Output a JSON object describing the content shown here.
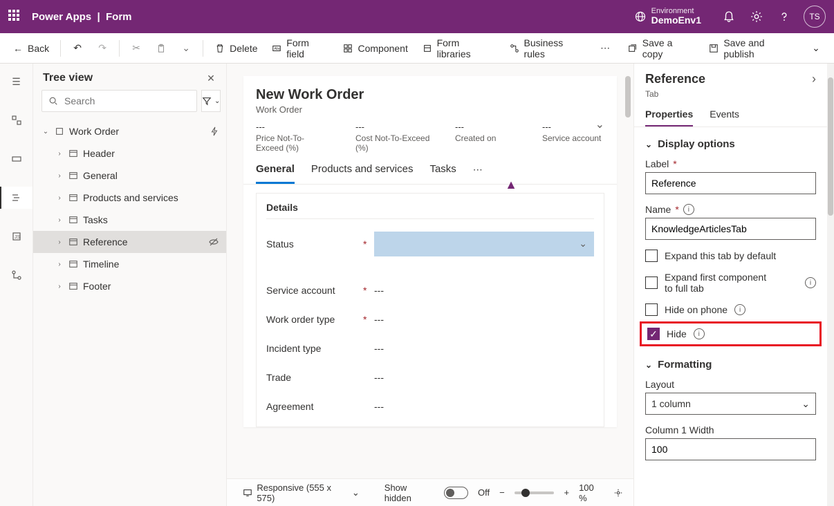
{
  "topbar": {
    "product": "Power Apps",
    "page": "Form",
    "env_label": "Environment",
    "env_name": "DemoEnv1",
    "avatar": "TS"
  },
  "commandbar": {
    "back": "Back",
    "delete": "Delete",
    "form_field": "Form field",
    "component": "Component",
    "form_libraries": "Form libraries",
    "business_rules": "Business rules",
    "save_copy": "Save a copy",
    "save_publish": "Save and publish"
  },
  "tree": {
    "title": "Tree view",
    "search_placeholder": "Search",
    "root": "Work Order",
    "items": [
      {
        "label": "Header"
      },
      {
        "label": "General"
      },
      {
        "label": "Products and services"
      },
      {
        "label": "Tasks"
      },
      {
        "label": "Reference",
        "selected": true,
        "hidden_icon": true
      },
      {
        "label": "Timeline"
      },
      {
        "label": "Footer"
      }
    ]
  },
  "form": {
    "title": "New Work Order",
    "entity": "Work Order",
    "header_fields": [
      {
        "value": "---",
        "label": "Price Not-To-Exceed (%)"
      },
      {
        "value": "---",
        "label": "Cost Not-To-Exceed (%)"
      },
      {
        "value": "---",
        "label": "Created on"
      },
      {
        "value": "---",
        "label": "Service account"
      }
    ],
    "tabs": [
      {
        "label": "General",
        "active": true
      },
      {
        "label": "Products and services"
      },
      {
        "label": "Tasks"
      }
    ],
    "section_title": "Details",
    "fields": [
      {
        "label": "Status",
        "required": true,
        "value": "",
        "type": "lookup"
      },
      {
        "label": "Service account",
        "required": true,
        "value": "---"
      },
      {
        "label": "Work order type",
        "required": true,
        "value": "---"
      },
      {
        "label": "Incident type",
        "required": false,
        "value": "---"
      },
      {
        "label": "Trade",
        "required": false,
        "value": "---"
      },
      {
        "label": "Agreement",
        "required": false,
        "value": "---"
      }
    ]
  },
  "footer": {
    "responsive": "Responsive (555 x 575)",
    "show_hidden": "Show hidden",
    "toggle_state": "Off",
    "zoom": "100 %"
  },
  "props": {
    "title": "Reference",
    "subtitle": "Tab",
    "tabs": {
      "properties": "Properties",
      "events": "Events"
    },
    "group_display": "Display options",
    "label_label": "Label",
    "label_value": "Reference",
    "name_label": "Name",
    "name_value": "KnowledgeArticlesTab",
    "expand_default": "Expand this tab by default",
    "expand_full": "Expand first component to full tab",
    "hide_phone": "Hide on phone",
    "hide": "Hide",
    "group_formatting": "Formatting",
    "layout_label": "Layout",
    "layout_value": "1 column",
    "col_width_label": "Column 1 Width",
    "col_width_value": "100",
    "required_mark": "*"
  }
}
